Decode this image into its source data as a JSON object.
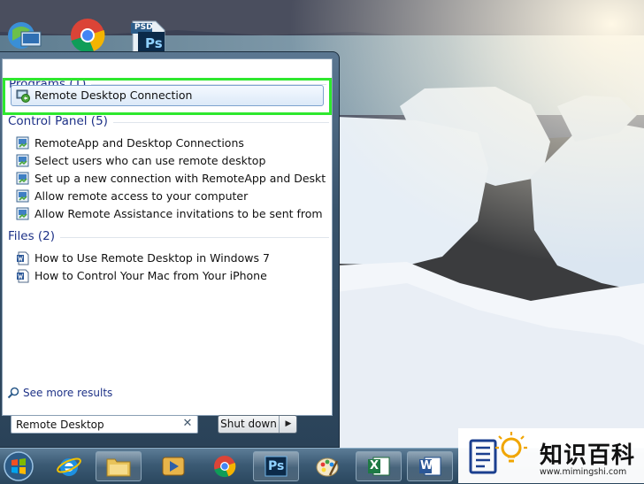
{
  "start_menu": {
    "groups": [
      {
        "title": "Programs (1)"
      },
      {
        "title": "Control Panel (5)"
      },
      {
        "title": "Files (2)"
      }
    ],
    "programs": [
      {
        "label": "Remote Desktop Connection",
        "icon": "remote-desktop-icon"
      }
    ],
    "control_panel": [
      {
        "label": "RemoteApp and Desktop Connections",
        "icon": "control-panel-icon"
      },
      {
        "label": "Select users who can use remote desktop",
        "icon": "control-panel-icon"
      },
      {
        "label": "Set up a new connection with RemoteApp and Desktop Conne...",
        "icon": "control-panel-icon"
      },
      {
        "label": "Allow remote access to your computer",
        "icon": "control-panel-icon"
      },
      {
        "label": "Allow Remote Assistance invitations to be sent from this comp...",
        "icon": "control-panel-icon"
      }
    ],
    "files": [
      {
        "label": "How to Use Remote Desktop in Windows 7",
        "icon": "word-document-icon"
      },
      {
        "label": "How to Control Your Mac from Your iPhone",
        "icon": "word-document-icon"
      }
    ],
    "see_more": "See more results",
    "search": {
      "value": "Remote Desktop"
    },
    "shutdown_label": "Shut down"
  },
  "desktop": {
    "icons": [
      "network-icon",
      "chrome-icon",
      "photoshop-file-icon"
    ],
    "psd_label": "PSD",
    "ps_label": "Ps"
  },
  "taskbar": {
    "items": [
      "start-orb-icon",
      "internet-explorer-icon",
      "file-explorer-icon",
      "media-player-icon",
      "chrome-icon",
      "photoshop-icon",
      "paint-icon",
      "excel-icon",
      "word-icon"
    ],
    "ps_label": "Ps",
    "excel_label": "X",
    "word_label": "W"
  },
  "watermark": {
    "text": "知识百科",
    "url": "www.mimingshi.com"
  },
  "colors": {
    "highlight": "#2ee82e",
    "group_header": "#1e3287",
    "taskbar": "#3b5a74"
  }
}
